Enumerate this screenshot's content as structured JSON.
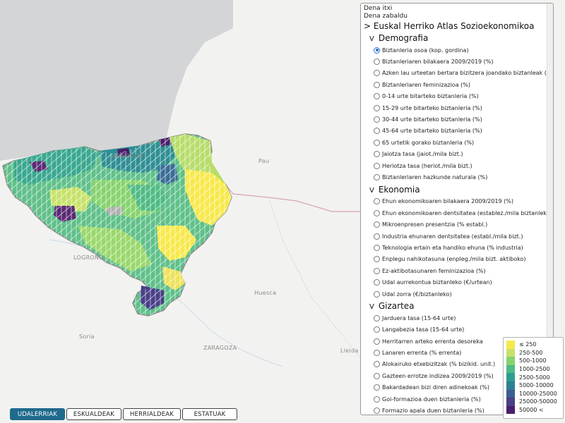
{
  "map": {
    "places": [
      "DONOSTIA",
      "Pau",
      "LOGROÑO",
      "Huesca",
      "Soria",
      "ZARAGOZA",
      "Lleida"
    ]
  },
  "panel": {
    "collapse_all": "Dena itxi",
    "expand_all": "Dena zabaldu",
    "root_title": "> Euskal Herriko Atlas Sozioekonomikoa",
    "sections": [
      {
        "title": "Demografia",
        "items": [
          "Biztanleria osoa (kop. gordina)",
          "Biztanleriaren bilakaera 2009/2019 (%)",
          "Azken lau urteetan bertara bizitzera joandako biztanleak (%)",
          "Biztanleriaren feminizazioa (%)",
          "0-14 urte bitarteko biztanleria (%)",
          "15-29 urte bitarteko biztanleria (%)",
          "30-44 urte bitarteko biztanleria (%)",
          "45-64 urte bitarteko biztanleria (%)",
          "65 urtetik gorako biztanleria (%)",
          "Jaiotza tasa (jaiot./mila bizt.)",
          "Heriotza tasa (heriot./mila bizt.)",
          "Biztanleriaren hazkunde naturala (%)"
        ]
      },
      {
        "title": "Ekonomia",
        "items": [
          "Ehun ekonomikoaren bilakaera 2009/2019 (%)",
          "Ehun ekonomikoaren dentsitatea (establez./mila biztanleko)",
          "Mikroenpresen presentzia (% establ.)",
          "Industria ehunaren dentsitatea (establ./mila bizt.)",
          "Teknologia ertain eta handiko ehuna (% industria)",
          "Enplegu nahikotasuna (enpleg./mila bizt. aktiboko)",
          "Ez-aktibotasunaren feminizazioa (%)",
          "Udal aurrekontua biztanleko (€/urtean)",
          "Udal zorra (€/biztanleko)"
        ]
      },
      {
        "title": "Gizartea",
        "items": [
          "Jarduera tasa (15-64 urte)",
          "Langabezia tasa (15-64 urte)",
          "Herritarren arteko errenta desoreka",
          "Lanaren errenta (% errenta)",
          "Alokairuko etxebizitzak (% bizikid. unit.)",
          "Gazteen errotze indizea 2009/2019 (%)",
          "Bakardadean bizi diren adinekoak (%)",
          "Goi-formazioa duen biztanleria (%)",
          "Formazio apala duen biztanleria (%)"
        ]
      }
    ],
    "selected": "Biztanleria osoa (kop. gordina)"
  },
  "legend": {
    "items": [
      {
        "label": "≤ 250",
        "color": "#f7e94c"
      },
      {
        "label": "250-500",
        "color": "#c7e26a"
      },
      {
        "label": "500-1000",
        "color": "#87d36e"
      },
      {
        "label": "1000-2500",
        "color": "#4fbb84"
      },
      {
        "label": "2500-5000",
        "color": "#2e9e8f"
      },
      {
        "label": "5000-10000",
        "color": "#2f7f93"
      },
      {
        "label": "10000-25000",
        "color": "#3b5f93"
      },
      {
        "label": "25000-50000",
        "color": "#4a3f88"
      },
      {
        "label": "50000 <",
        "color": "#4b1d6b"
      }
    ]
  },
  "tabs": [
    {
      "label": "UDALERRIAK",
      "active": true
    },
    {
      "label": "ESKUALDEAK",
      "active": false
    },
    {
      "label": "HERRIALDEAK",
      "active": false
    },
    {
      "label": "ESTATUAK",
      "active": false
    }
  ]
}
